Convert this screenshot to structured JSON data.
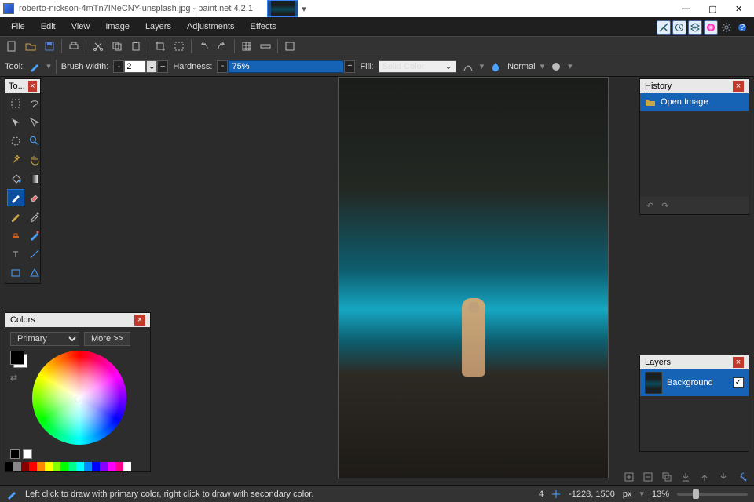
{
  "window": {
    "title": "roberto-nickson-4mTn7INeCNY-unsplash.jpg - paint.net 4.2.1",
    "controls": {
      "min": "—",
      "max": "▢",
      "close": "✕"
    }
  },
  "menu": {
    "items": [
      "File",
      "Edit",
      "View",
      "Image",
      "Layers",
      "Adjustments",
      "Effects"
    ]
  },
  "toolbar2": {
    "tool_label": "Tool:",
    "brush_label": "Brush width:",
    "brush_value": "2",
    "hardness_label": "Hardness:",
    "hardness_value": "75%",
    "fill_label": "Fill:",
    "fill_value": "Solid Color",
    "blend_label": "Normal"
  },
  "toolbox": {
    "title": "To..."
  },
  "colors": {
    "title": "Colors",
    "selector": "Primary",
    "more": "More >>",
    "palette": [
      "#000",
      "#888",
      "#800",
      "#f00",
      "#f80",
      "#ff0",
      "#8f0",
      "#0f0",
      "#0f8",
      "#0ff",
      "#08f",
      "#00f",
      "#80f",
      "#f0f",
      "#f08",
      "#fff"
    ]
  },
  "history": {
    "title": "History",
    "item": "Open Image"
  },
  "layers": {
    "title": "Layers",
    "item": "Background"
  },
  "status": {
    "hint": "Left click to draw with primary color, right click to draw with secondary color.",
    "count": "4",
    "coords": "-1228, 1500",
    "unit": "px",
    "zoom": "13%"
  }
}
